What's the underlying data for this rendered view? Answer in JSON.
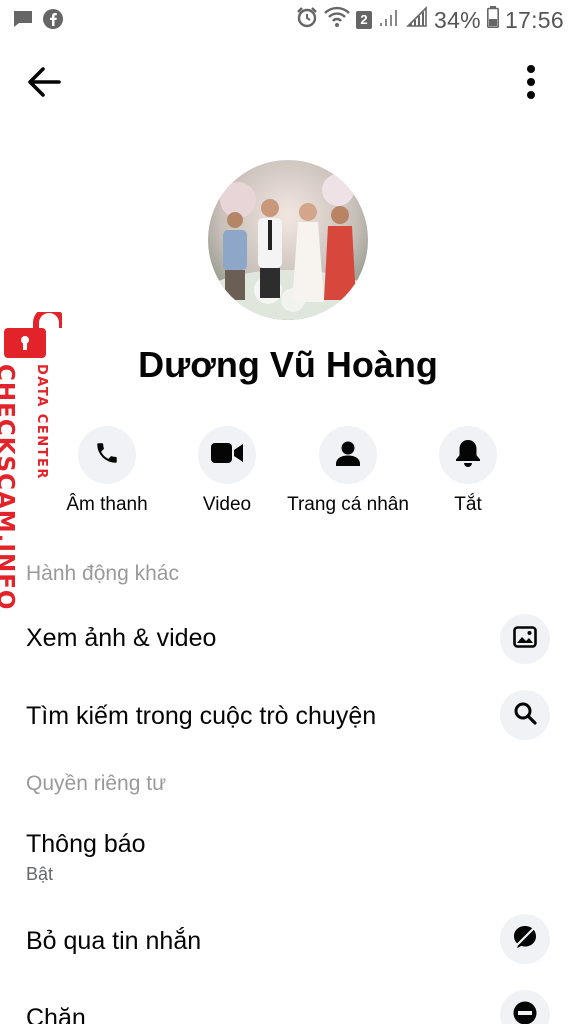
{
  "status_bar": {
    "battery": "34%",
    "time": "17:56",
    "wifi_badge": "2",
    "icons": [
      "chat-bubble-icon",
      "facebook-icon",
      "alarm-icon",
      "wifi-icon",
      "signal-icon",
      "signal-icon",
      "battery-icon"
    ]
  },
  "header": {
    "back_icon": "arrow-left-icon",
    "more_icon": "more-vertical-icon"
  },
  "profile": {
    "name": "Dương Vũ Hoàng",
    "avatar": "profile-photo"
  },
  "actions": [
    {
      "label": "Âm thanh",
      "icon": "phone-icon"
    },
    {
      "label": "Video",
      "icon": "video-camera-icon"
    },
    {
      "label": "Trang cá nhân",
      "icon": "person-icon"
    },
    {
      "label": "Tắt",
      "icon": "bell-icon"
    }
  ],
  "sections": {
    "more_actions": "Hành động khác",
    "privacy": "Quyền riêng tư"
  },
  "rows": {
    "view_media": {
      "label": "Xem ảnh & video",
      "icon": "image-icon"
    },
    "search_chat": {
      "label": "Tìm kiếm trong cuộc trò chuyện",
      "icon": "search-icon"
    },
    "notifications": {
      "label": "Thông báo",
      "sub": "Bật"
    },
    "ignore_messages": {
      "label": "Bỏ qua tin nhắn",
      "icon": "ignore-icon"
    },
    "block": {
      "label": "Chặn",
      "icon": "block-icon"
    }
  },
  "watermark": {
    "main": "CHECKSCAM.INFO",
    "sub": "DATA CENTER",
    "color": "#e3232a"
  },
  "colors": {
    "text": "#050505",
    "muted": "#9a9a9a",
    "icon_bg": "#f0f2f5"
  }
}
